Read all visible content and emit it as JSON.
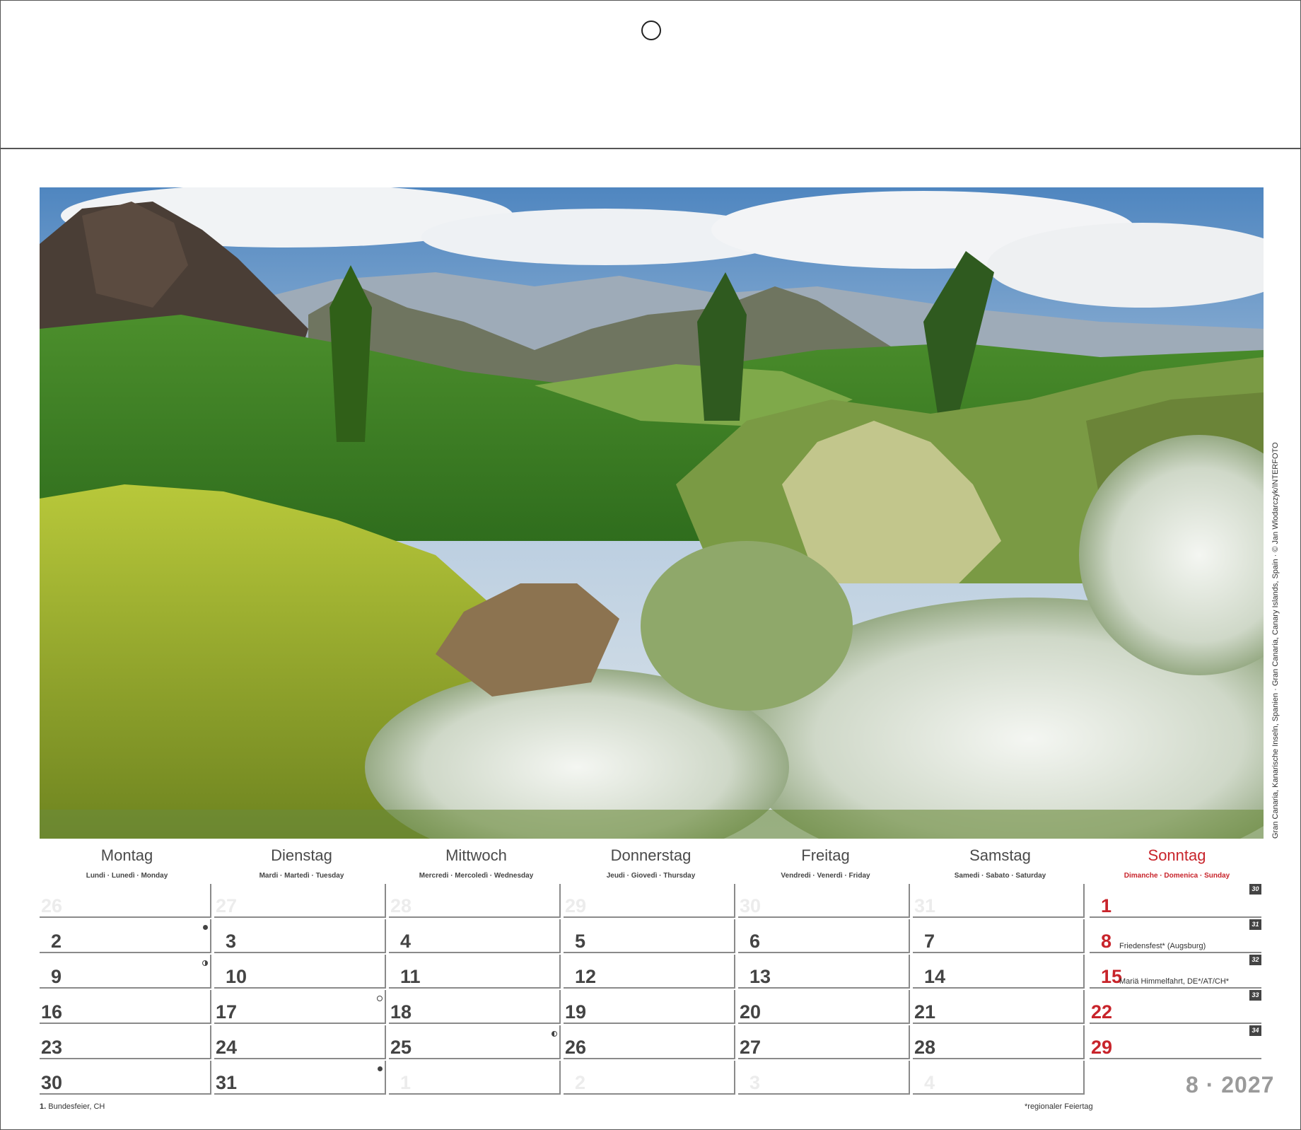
{
  "calendar": {
    "month_year": "8 · 2027",
    "photo_credit": "Gran Canaria, Kanarische Inseln, Spanien · Gran Canaria, Canary Islands, Spain · © Jan Wlodarczyk/INTERFOTO",
    "weekdays": [
      {
        "name": "Montag",
        "sub": "Lundi · Lunedì · Monday"
      },
      {
        "name": "Dienstag",
        "sub": "Mardi · Martedì · Tuesday"
      },
      {
        "name": "Mittwoch",
        "sub": "Mercredi · Mercoledì · Wednesday"
      },
      {
        "name": "Donnerstag",
        "sub": "Jeudi · Giovedì · Thursday"
      },
      {
        "name": "Freitag",
        "sub": "Vendredi · Venerdì · Friday"
      },
      {
        "name": "Samstag",
        "sub": "Samedi · Sabato · Saturday"
      },
      {
        "name": "Sonntag",
        "sub": "Dimanche · Domenica · Sunday"
      }
    ],
    "weeks": [
      {
        "week_no": "30",
        "days": [
          "26",
          "27",
          "28",
          "29",
          "30",
          "31",
          "1"
        ]
      },
      {
        "week_no": "31",
        "days": [
          "2",
          "3",
          "4",
          "5",
          "6",
          "7",
          "8"
        ]
      },
      {
        "week_no": "32",
        "days": [
          "9",
          "10",
          "11",
          "12",
          "13",
          "14",
          "15"
        ]
      },
      {
        "week_no": "33",
        "days": [
          "16",
          "17",
          "18",
          "19",
          "20",
          "21",
          "22"
        ]
      },
      {
        "week_no": "34",
        "days": [
          "23",
          "24",
          "25",
          "26",
          "27",
          "28",
          "29"
        ]
      },
      {
        "week_no": "",
        "days": [
          "30",
          "31",
          "1",
          "2",
          "3",
          "4",
          ""
        ]
      }
    ],
    "holidays": {
      "aug8": "Friedensfest* (Augsburg)",
      "aug15": "Mariä Himmelfahrt, DE*/AT/CH*"
    },
    "footer_left_bold": "1.",
    "footer_left_text": " Bundesfeier, CH",
    "footer_right": "*regionaler Feiertag",
    "colors": {
      "sunday_red": "#c8242b",
      "grid": "#8a8a8a",
      "muted_digits": "#ececec"
    }
  }
}
